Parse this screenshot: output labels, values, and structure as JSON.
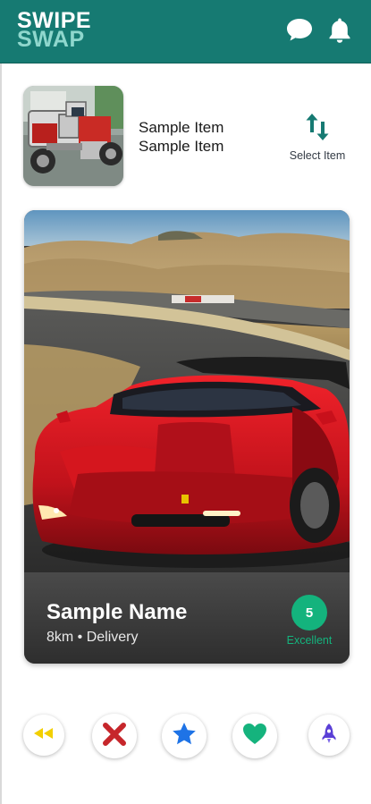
{
  "app": {
    "logo_line1": "SWIPE",
    "logo_line2": "SWAP",
    "header_bg": "#167a72"
  },
  "header": {
    "icons": [
      "chat-icon",
      "bell-icon"
    ]
  },
  "selected_item": {
    "title": "Sample Item",
    "subtitle": "Sample Item",
    "select_label": "Select Item",
    "select_icon": "swap-vertical-icon"
  },
  "card": {
    "name": "Sample Name",
    "subtitle": "8km • Delivery",
    "rating": "5",
    "rating_label": "Excellent",
    "rating_color": "#14b37d"
  },
  "actions": [
    {
      "name": "rewind",
      "icon": "rewind-icon",
      "color": "#f2cf00"
    },
    {
      "name": "dislike",
      "icon": "close-icon",
      "color": "#c6262b"
    },
    {
      "name": "super-like",
      "icon": "star-icon",
      "color": "#1e73e6"
    },
    {
      "name": "like",
      "icon": "heart-icon",
      "color": "#15b37d"
    },
    {
      "name": "boost",
      "icon": "rocket-icon",
      "color": "#5a3fd6"
    }
  ]
}
